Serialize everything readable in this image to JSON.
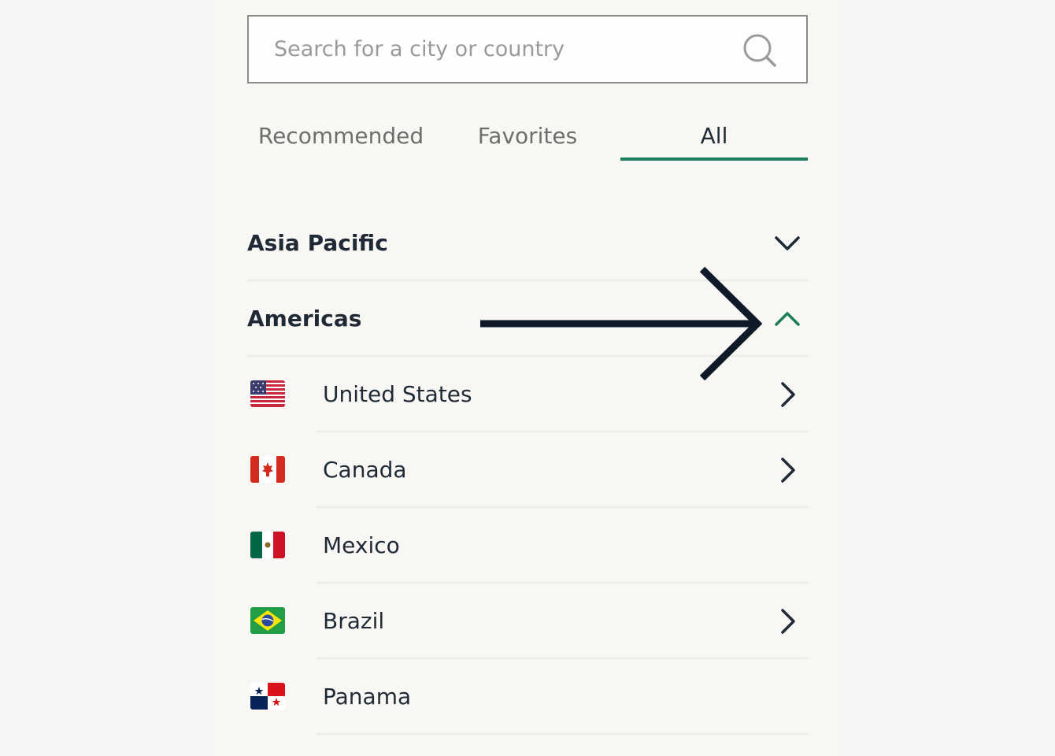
{
  "search": {
    "placeholder": "Search for a city or country",
    "value": ""
  },
  "tabs": [
    {
      "label": "Recommended",
      "active": false
    },
    {
      "label": "Favorites",
      "active": false
    },
    {
      "label": "All",
      "active": true
    }
  ],
  "regions": [
    {
      "label": "Asia Pacific",
      "expanded": false
    },
    {
      "label": "Americas",
      "expanded": true
    }
  ],
  "countries": [
    {
      "label": "United States",
      "flag": "us-flag-icon",
      "has_submenu": true
    },
    {
      "label": "Canada",
      "flag": "canada-flag-icon",
      "has_submenu": true
    },
    {
      "label": "Mexico",
      "flag": "mexico-flag-icon",
      "has_submenu": false
    },
    {
      "label": "Brazil",
      "flag": "brazil-flag-icon",
      "has_submenu": true
    },
    {
      "label": "Panama",
      "flag": "panama-flag-icon",
      "has_submenu": false
    }
  ],
  "colors": {
    "accent": "#1c7d5c",
    "text": "#1f2a36",
    "muted": "#6e6e6e"
  }
}
